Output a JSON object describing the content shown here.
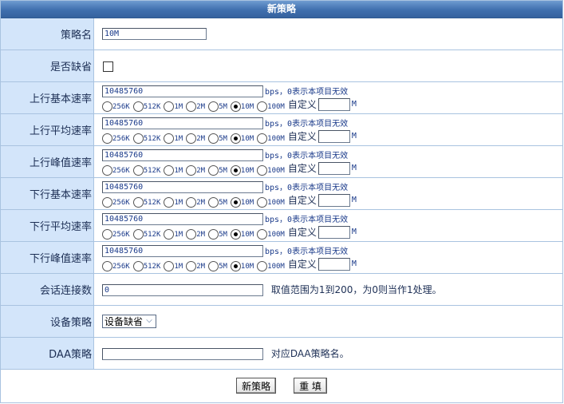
{
  "header": {
    "title": "新策略"
  },
  "fields": {
    "policy_name": {
      "label": "策略名",
      "value": "10M"
    },
    "is_default": {
      "label": "是否缺省",
      "checked": false
    },
    "sessions": {
      "label": "会话连接数",
      "value": "0",
      "hint": "取值范围为1到200，为0则当作1处理。"
    },
    "device_policy": {
      "label": "设备策略",
      "selected": "设备缺省"
    },
    "daa_policy": {
      "label": "DAA策略",
      "value": "",
      "hint": "对应DAA策略名。"
    }
  },
  "rate_common": {
    "unit_hint": "bps，0表示本项目无效",
    "options": [
      "256K",
      "512K",
      "1M",
      "2M",
      "5M",
      "10M",
      "100M"
    ],
    "selected_option": "10M",
    "custom_label": "自定义",
    "custom_unit": "M"
  },
  "rates": [
    {
      "label": "上行基本速率",
      "value": "10485760",
      "custom": ""
    },
    {
      "label": "上行平均速率",
      "value": "10485760",
      "custom": ""
    },
    {
      "label": "上行峰值速率",
      "value": "10485760",
      "custom": ""
    },
    {
      "label": "下行基本速率",
      "value": "10485760",
      "custom": ""
    },
    {
      "label": "下行平均速率",
      "value": "10485760",
      "custom": ""
    },
    {
      "label": "下行峰值速率",
      "value": "10485760",
      "custom": ""
    }
  ],
  "buttons": {
    "submit": "新策略",
    "reset": "重 填"
  }
}
